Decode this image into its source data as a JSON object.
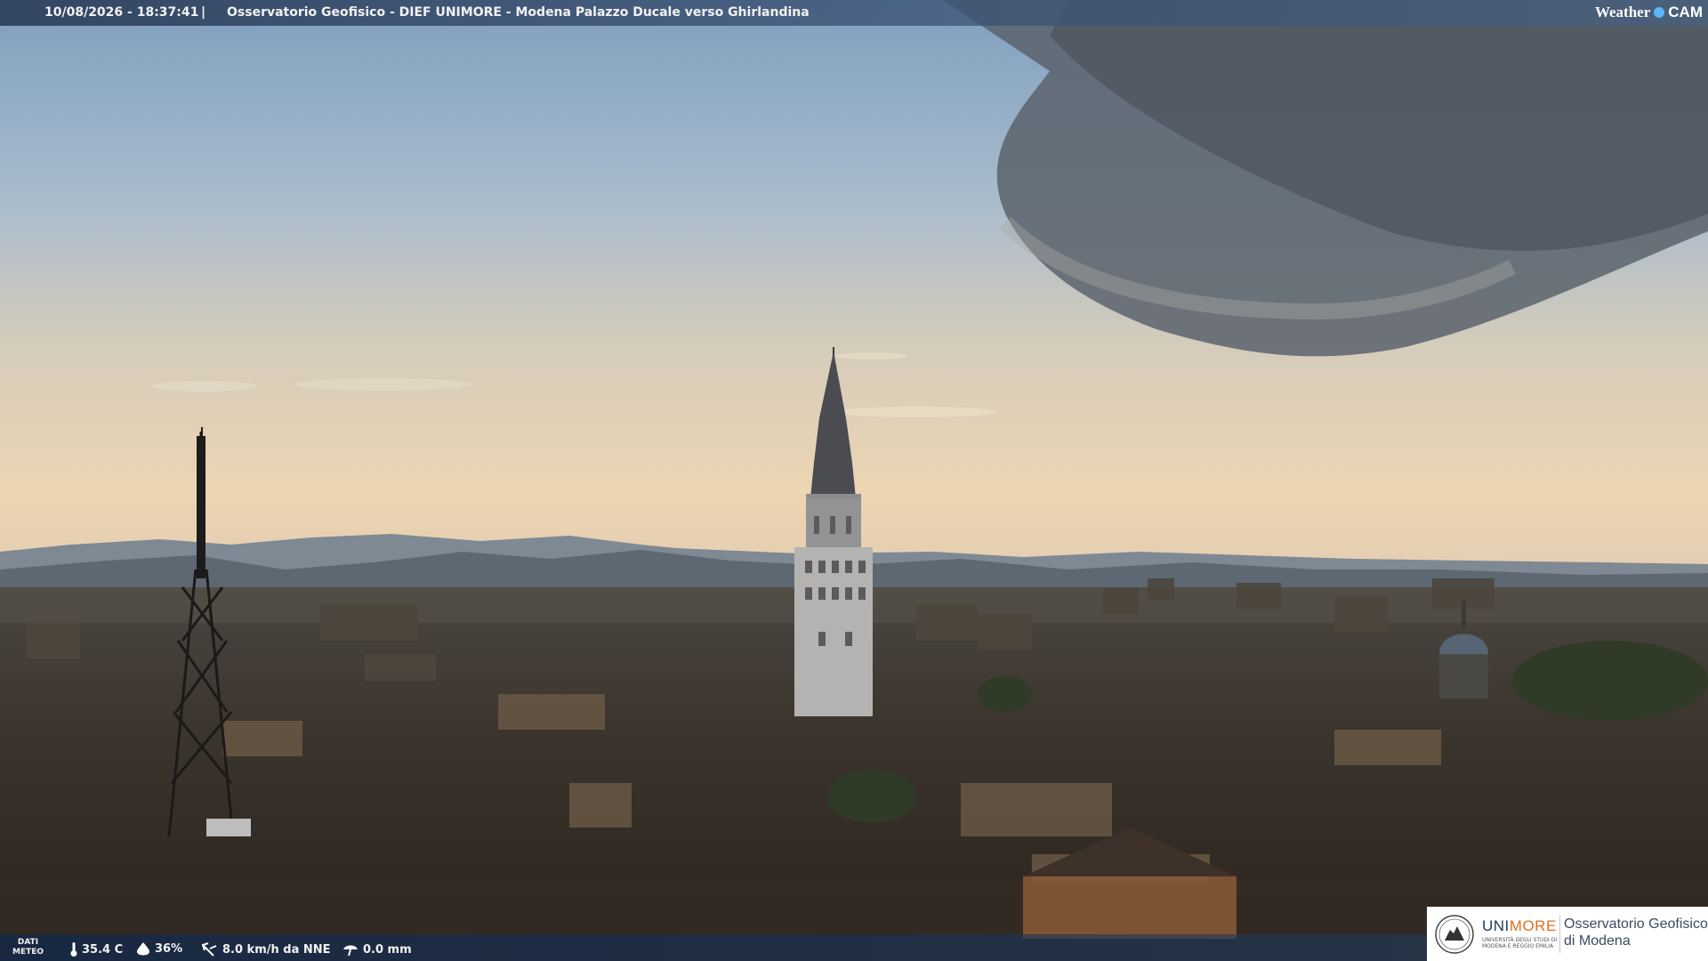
{
  "header": {
    "timestamp": "10/08/2026 - 18:37:41",
    "separator": "|",
    "title": "Osservatorio Geofisico - DIEF UNIMORE - Modena Palazzo Ducale verso Ghirlandina",
    "logo_weather": "Weather",
    "logo_cam": "CAM"
  },
  "weather": {
    "label_line1": "DATI",
    "label_line2": "METEO",
    "temperature": "35.4 C",
    "humidity": "36%",
    "wind": "8.0 km/h da NNE",
    "rain": "0.0 mm",
    "icons": [
      "thermometer-icon",
      "humidity-drop-icon",
      "wind-icon",
      "rain-gauge-icon"
    ]
  },
  "branding": {
    "unimore_a": "UNI",
    "unimore_b": "MORE",
    "unimore_sub": "UNIVERSITÀ DEGLI STUDI DI MODENA E REGGIO EMILIA",
    "observatory_line1": "Osservatorio Geofisico",
    "observatory_line2": "di Modena"
  },
  "colors": {
    "bar": "#2c4468",
    "unimore_blue": "#223a5e",
    "unimore_orange": "#e36d1c"
  }
}
